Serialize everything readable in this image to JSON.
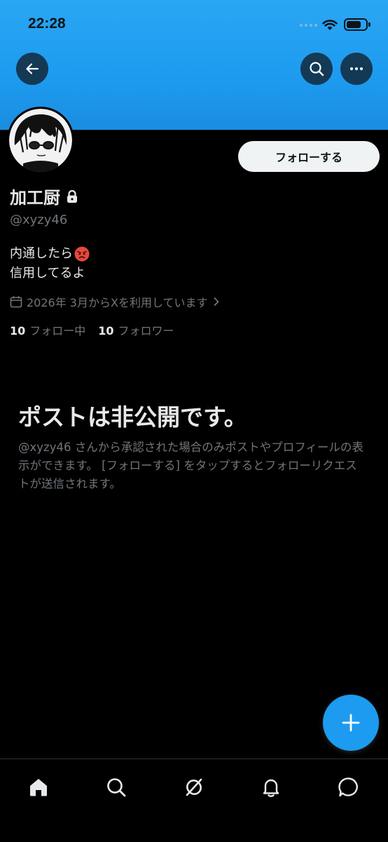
{
  "status_bar": {
    "time": "22:28"
  },
  "header": {
    "back_icon": "arrow-left-icon",
    "search_icon": "search-icon",
    "more_icon": "more-horizontal-icon",
    "banner_color": "#1d9bf0"
  },
  "profile": {
    "name": "加工厨",
    "handle": "@xyzy46",
    "locked": true,
    "follow_label": "フォローする",
    "bio_line1": "内通したら",
    "bio_line1_emoji": "angry-face-emoji",
    "bio_line2": "信用してるよ",
    "joined": "2026年 3月からXを利用しています",
    "following_count": "10",
    "following_label": "フォロー中",
    "followers_count": "10",
    "followers_label": "フォロワー"
  },
  "private_notice": {
    "title": "ポストは非公開です。",
    "description": "@xyzy46 さんから承認された場合のみポストやプロフィールの表示ができます。 [フォローする] をタップするとフォローリクエストが送信されます。"
  },
  "fab": {
    "icon": "plus-icon",
    "color": "#1d9bf0"
  },
  "tabbar": {
    "items": [
      "home-icon",
      "search-icon",
      "grok-icon",
      "notifications-icon",
      "messages-icon"
    ]
  }
}
